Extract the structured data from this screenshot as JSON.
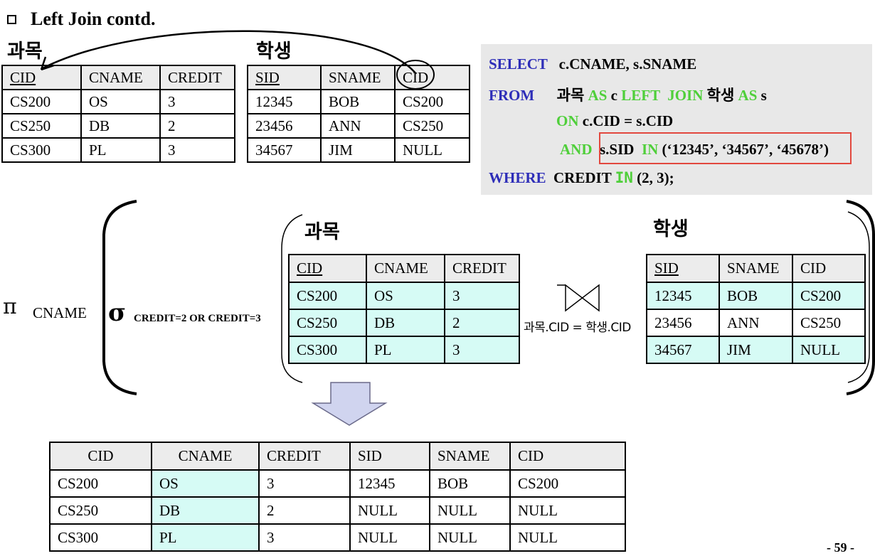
{
  "slide": {
    "title": "Left Join  contd.",
    "page_number": "- 59 -"
  },
  "top": {
    "course_label": "과목",
    "student_label": "학생",
    "course_table": {
      "headers": [
        "CID",
        "CNAME",
        "CREDIT"
      ],
      "rows": [
        [
          "CS200",
          "OS",
          "3"
        ],
        [
          "CS250",
          "DB",
          "2"
        ],
        [
          "CS300",
          "PL",
          "3"
        ]
      ]
    },
    "student_table": {
      "headers": [
        "SID",
        "SNAME",
        "CID"
      ],
      "rows": [
        [
          "12345",
          "BOB",
          "CS200"
        ],
        [
          "23456",
          "ANN",
          "CS250"
        ],
        [
          "34567",
          "JIM",
          "NULL"
        ]
      ]
    }
  },
  "sql": {
    "select_kw": "SELECT",
    "select_cols": "c.CNAME, s.SNAME",
    "from_kw": "FROM",
    "t1": "과목",
    "as1": "AS",
    "alias1": "c",
    "left_join": "LEFT  JOIN",
    "t2": "학생",
    "as2": "AS",
    "alias2": "s",
    "on_kw": "ON",
    "on_cond": "c.CID = s.CID",
    "and_kw": "AND",
    "sid_col": "s.SID",
    "in_kw": "IN",
    "in_list": "(‘12345’, ‘34567’, ‘45678’)",
    "where_kw": "WHERE",
    "credit_col": "CREDIT",
    "in_kw2": "IN",
    "credit_list": "(2, 3);"
  },
  "algebra": {
    "pi": "π",
    "project_attr": "CNAME",
    "sigma": "σ",
    "select_cond": "CREDIT=2 OR CREDIT=3",
    "course_label": "과목",
    "student_label": "학생",
    "join_cond": "과목.CID = 학생.CID",
    "course_table": {
      "headers": [
        "CID",
        "CNAME",
        "CREDIT"
      ],
      "rows": [
        [
          "CS200",
          "OS",
          "3"
        ],
        [
          "CS250",
          "DB",
          "2"
        ],
        [
          "CS300",
          "PL",
          "3"
        ]
      ]
    },
    "student_table": {
      "headers": [
        "SID",
        "SNAME",
        "CID"
      ],
      "rows": [
        [
          "12345",
          "BOB",
          "CS200"
        ],
        [
          "23456",
          "ANN",
          "CS250"
        ],
        [
          "34567",
          "JIM",
          "NULL"
        ]
      ]
    }
  },
  "result_table": {
    "headers": [
      "CID",
      "CNAME",
      "CREDIT",
      "SID",
      "SNAME",
      "CID"
    ],
    "rows": [
      [
        "CS200",
        "OS",
        "3",
        "12345",
        "BOB",
        "CS200"
      ],
      [
        "CS250",
        "DB",
        "2",
        "NULL",
        "NULL",
        "NULL"
      ],
      [
        "CS300",
        "PL",
        "3",
        "NULL",
        "NULL",
        "NULL"
      ]
    ]
  },
  "colors": {
    "keyword_blue": "#2e2eb8",
    "keyword_green": "#4fcf3a",
    "highlight_cell": "#d6fbf5",
    "sql_background": "#e8e8e8",
    "red_outline": "#e2483e",
    "arrow_fill": "#d0d4ef"
  }
}
